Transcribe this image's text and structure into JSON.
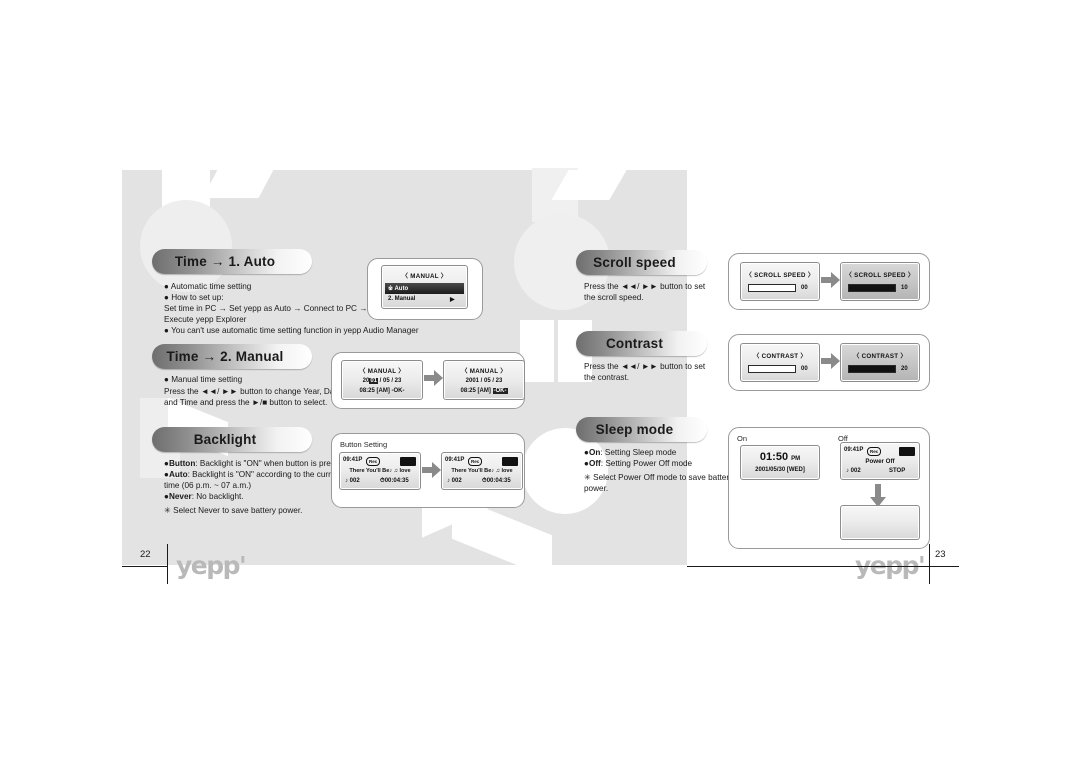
{
  "document": {
    "type": "product-manual-spread",
    "left_page_number": "22",
    "right_page_number": "23",
    "brand_logo": "yepp'"
  },
  "left_page": {
    "sections": [
      {
        "id": "time-auto",
        "heading": "Time → 1. Auto",
        "body_lines": [
          "● Automatic time setting",
          "● How to set up:",
          "Set time in PC → Set yepp as Auto → Connect to PC →",
          "Execute  yepp Explorer",
          "● You can't use automatic time setting function in yepp Audio Manager"
        ],
        "screens": [
          {
            "title": "〈 MANUAL 〉",
            "menu": [
              {
                "label": "※ Auto",
                "selected": true
              },
              {
                "label": "2. Manual",
                "selected": false,
                "arrow": "▶"
              }
            ]
          }
        ]
      },
      {
        "id": "time-manual",
        "heading": "Time → 2. Manual",
        "body_lines": [
          "● Manual time setting",
          "Press the ◄◄/ ►► button to change Year, Date",
          "and Time and press the ►/■ button to select."
        ],
        "screens": [
          {
            "title": "〈 MANUAL 〉",
            "date_prefix": "20",
            "date_highlight": "01",
            "date_suffix": " / 05 / 23",
            "time_line": "08:25 [AM]",
            "ok_label": "-OK-",
            "ok_highlighted": false
          },
          {
            "title": "〈 MANUAL 〉",
            "date_line": "2001 / 05 / 23",
            "time_line": "08:25 [AM]",
            "ok_label": "-OK-",
            "ok_highlighted": true
          }
        ]
      },
      {
        "id": "backlight",
        "heading": "Backlight",
        "body_lines": [
          "● Button: Backlight is \"ON\" when button is pressed",
          "● Auto: Backlight is \"ON\" according to the current",
          "time (06 p.m. ~ 07 a.m.)",
          "● Never: No backlight.",
          "✳ Select Never to save battery power."
        ],
        "illustration_label": "Button Setting",
        "screens": [
          {
            "clock": "09:41P",
            "badge": "Rec",
            "battery": "▮▮▮",
            "track_title": "There You'll Be♪ ♫ love",
            "track_number": "♪ 002",
            "elapsed": "00:04:35"
          },
          {
            "clock": "09:41P",
            "badge": "Rec",
            "battery": "▮▮▮",
            "track_title": "There You'll Be♪ ♫ love",
            "track_number": "♪ 002",
            "elapsed": "00:04:35"
          }
        ]
      }
    ]
  },
  "right_page": {
    "sections": [
      {
        "id": "scroll-speed",
        "heading": "Scroll speed",
        "body_lines": [
          "Press the ◄◄/ ►► button to set",
          "the scroll speed."
        ],
        "screens": [
          {
            "title": "〈 SCROLL SPEED 〉",
            "value": "00",
            "fill_percent": 0,
            "dark": false
          },
          {
            "title": "〈 SCROLL SPEED 〉",
            "value": "10",
            "fill_percent": 100,
            "dark": true
          }
        ]
      },
      {
        "id": "contrast",
        "heading": "Contrast",
        "body_lines": [
          "Press the ◄◄/ ►► button to set",
          "the contrast."
        ],
        "screens": [
          {
            "title": "〈 CONTRAST 〉",
            "value": "00",
            "fill_percent": 0,
            "dark": false
          },
          {
            "title": "〈 CONTRAST 〉",
            "value": "20",
            "fill_percent": 100,
            "dark": true
          }
        ]
      },
      {
        "id": "sleep-mode",
        "heading": "Sleep mode",
        "body_lines": [
          "●On: Setting Sleep mode",
          "●Off: Setting Power Off mode",
          "✳ Select Power Off mode to save battery",
          "power."
        ],
        "column_labels": {
          "on": "On",
          "off": "Off"
        },
        "on_screen": {
          "time": "01",
          "separator": ":",
          "minutes": "50",
          "meridiem": "PM",
          "date": "2001/05/30 [WED]"
        },
        "off_screen": {
          "clock": "09:41P",
          "badge": "Rec",
          "battery": "▮▮▮",
          "status": "Power Off",
          "track_number": "♪ 002",
          "transport": "STOP"
        },
        "off_screen_blank": {
          "content": ""
        }
      }
    ]
  },
  "colors": {
    "page_background": "#ffffff",
    "spread_background": "#e3e3e3",
    "watermark": "#f2f2f2",
    "pill_dark": "#6e6e6e",
    "pill_light": "#ffffff",
    "text": "#1a1a1a",
    "logo": "#b9b9b9"
  }
}
